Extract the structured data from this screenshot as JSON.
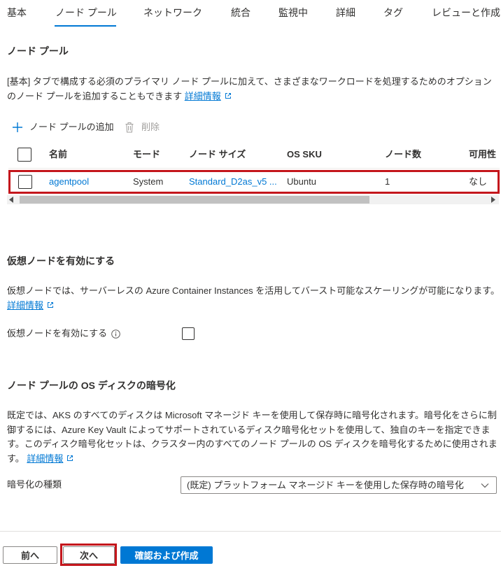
{
  "tabs": [
    {
      "label": "基本",
      "selected": false
    },
    {
      "label": "ノード プール",
      "selected": true
    },
    {
      "label": "ネットワーク",
      "selected": false
    },
    {
      "label": "統合",
      "selected": false
    },
    {
      "label": "監視中",
      "selected": false
    },
    {
      "label": "詳細",
      "selected": false
    },
    {
      "label": "タグ",
      "selected": false
    },
    {
      "label": "レビューと作成",
      "selected": false
    }
  ],
  "node_pools": {
    "heading": "ノード プール",
    "description": "[基本] タブで構成する必須のプライマリ ノード プールに加えて、さまざまなワークロードを処理するためのオプションのノード プールを追加することもできます",
    "learn_more": "詳細情報",
    "toolbar": {
      "add_label": "ノード プールの追加",
      "add_icon": "plus-icon",
      "delete_label": "削除",
      "delete_icon": "trash-icon",
      "delete_disabled": true
    },
    "table": {
      "select_all_checked": false,
      "columns": [
        "名前",
        "モード",
        "ノード サイズ",
        "OS SKU",
        "ノード数",
        "可用性"
      ],
      "rows": [
        {
          "checked": false,
          "cells": [
            "agentpool",
            "System",
            "Standard_D2as_v5 ...",
            "Ubuntu",
            "1",
            "なし"
          ]
        }
      ]
    }
  },
  "virtual_nodes": {
    "heading": "仮想ノードを有効にする",
    "description": "仮想ノードでは、サーバーレスの Azure Container Instances を活用してバースト可能なスケーリングが可能になります。",
    "learn_more": "詳細情報",
    "field_label": "仮想ノードを有効にする",
    "info_icon": "info-icon",
    "checked": false
  },
  "encryption": {
    "heading": "ノード プールの OS ディスクの暗号化",
    "description": "既定では、AKS のすべてのディスクは Microsoft マネージド キーを使用して保存時に暗号化されます。暗号化をさらに制御するには、Azure Key Vault によってサポートされているディスク暗号化セットを使用して、独自のキーを指定できます。このディスク暗号化セットは、クラスター内のすべてのノード プールの OS ディスクを暗号化するために使用されます。",
    "learn_more": "詳細情報",
    "field_label": "暗号化の種類",
    "selected_option": "(既定) プラットフォーム マネージド キーを使用した保存時の暗号化"
  },
  "footer": {
    "prev_label": "前へ",
    "next_label": "次へ",
    "review_label": "確認および作成"
  },
  "colors": {
    "accent": "#0078d4",
    "text": "#323130",
    "disabled": "#a19f9d",
    "annotation_red": "#c4161c"
  }
}
